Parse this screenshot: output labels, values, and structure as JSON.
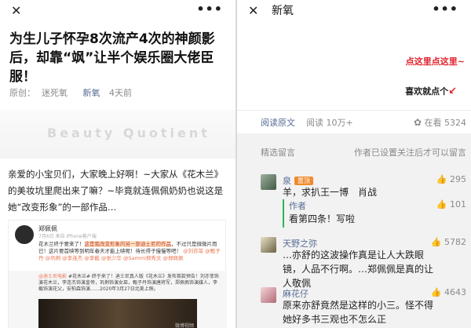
{
  "left": {
    "topbar": {
      "close": "✕",
      "more": "•••"
    },
    "headline": "为生儿子怀孕8次流产4次的神颜影后，却靠“飒”让半个娱乐圈大佬臣服！",
    "meta": {
      "label": "原创：",
      "author": "迷死氧",
      "account": "新氧",
      "time": "4天前"
    },
    "watermark": "Beauty Quotient",
    "paragraph": "亲爱的小宝贝们，大家晚上好啊！~大家从《花木兰》的美妆坑里爬出来了嘛？~毕竟就连佩佩奶奶也说这是她“改变形象”的一部作品…",
    "weibo": {
      "name": "郑佩佩",
      "time": "7月6日 来自 iPhone客户端",
      "body_plain": "花木兰终于要来了！",
      "body_highlight": "这是我改变形象的另一部迪士尼的作品",
      "body_rest": "，不过只是微微片而已！这片要首映等到明年春天才能上映呢！待长得子慢慢等吧！",
      "tags": "@刘亦菲 @甄子丹 @巩俐 @李连杰 @李截 @张少华 @Sammi郑秀文 @郑佩佩",
      "share_tag": "@迪士尼电影",
      "share_text": "#花木兰# 终于来了！迪士尼真人版《花木兰》发布首款预告！刘亦菲饰演花木兰，李连杰饰演皇帝，巩俐饰演女巫，甄子丹饰演唐将军，郑佩佩饰演媒人，李截饰演花父，安柏森饰演……2020年3月27日北美上映。",
      "video_mark": "微博视频"
    }
  },
  "right": {
    "topbar": {
      "close": "✕",
      "title": "新氧",
      "more": "•••"
    },
    "cta_red": "点这里点这里~",
    "cta_like": "喜欢就点个",
    "stats": {
      "read_original": "阅读原文",
      "read_count": "阅读 10万+",
      "lookers": "在看 5324"
    },
    "comments_header": {
      "title": "精选留言",
      "note": "作者已设置关注后才可以留言"
    },
    "comments": [
      {
        "name": "泉",
        "badge": "置顶",
        "likes": "295",
        "text": "羊，求扒王一博　肖战"
      },
      {
        "name": "天野之弥",
        "likes": "5782",
        "text": "…亦舒的这波操作真是让人大跌眼镜，人品不行啊。…郑佩佩是真的让人敬佩"
      },
      {
        "name": "麻花仔",
        "likes": "4643",
        "text": "原来亦舒竟然是这样的小三。怪不得她好多书三观也不怎么正"
      }
    ],
    "reply": {
      "name": "作者",
      "likes": "101",
      "text": "看第四条！写啦"
    },
    "colors": {
      "link": "#576b95",
      "badge": "#f08a2b",
      "accent_red": "#e0202b",
      "reply_bar": "#2db55d"
    }
  }
}
